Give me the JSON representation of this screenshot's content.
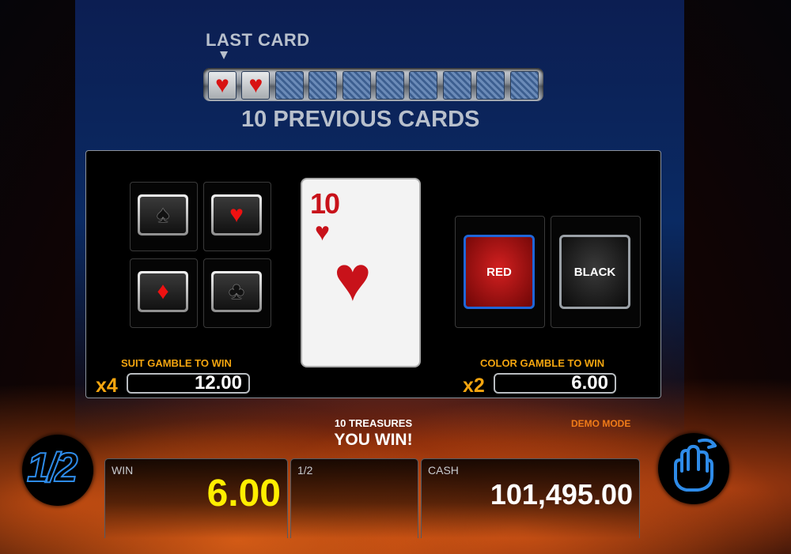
{
  "history": {
    "label": "LAST CARD",
    "caption": "10 PREVIOUS CARDS",
    "cards": [
      "heart",
      "heart",
      "back",
      "back",
      "back",
      "back",
      "back",
      "back",
      "back",
      "back"
    ]
  },
  "suit_gamble": {
    "label": "SUIT GAMBLE TO WIN",
    "multiplier": "x4",
    "value": "12.00",
    "suits": [
      {
        "name": "spades",
        "glyph": "♠"
      },
      {
        "name": "hearts",
        "glyph": "♥"
      },
      {
        "name": "diamonds",
        "glyph": "♦"
      },
      {
        "name": "clubs",
        "glyph": "♣"
      }
    ]
  },
  "current_card": {
    "rank": "10",
    "suit_glyph": "♥",
    "suit": "hearts",
    "color": "#c8121a"
  },
  "color_gamble": {
    "label": "COLOR GAMBLE TO WIN",
    "multiplier": "x2",
    "value": "6.00",
    "red_label": "RED",
    "black_label": "BLACK"
  },
  "game_title": "10 TREASURES",
  "status": "YOU WIN!",
  "mode": "DEMO MODE",
  "bottom": {
    "half_button": "1/2",
    "win_label": "WIN",
    "win_value": "6.00",
    "half_label": "1/2",
    "cash_label": "CASH",
    "cash_value": "101,495.00"
  },
  "colors": {
    "accent_orange": "#f4a50f",
    "win_yellow": "#ffee00",
    "selection_blue": "#1f66d8"
  }
}
